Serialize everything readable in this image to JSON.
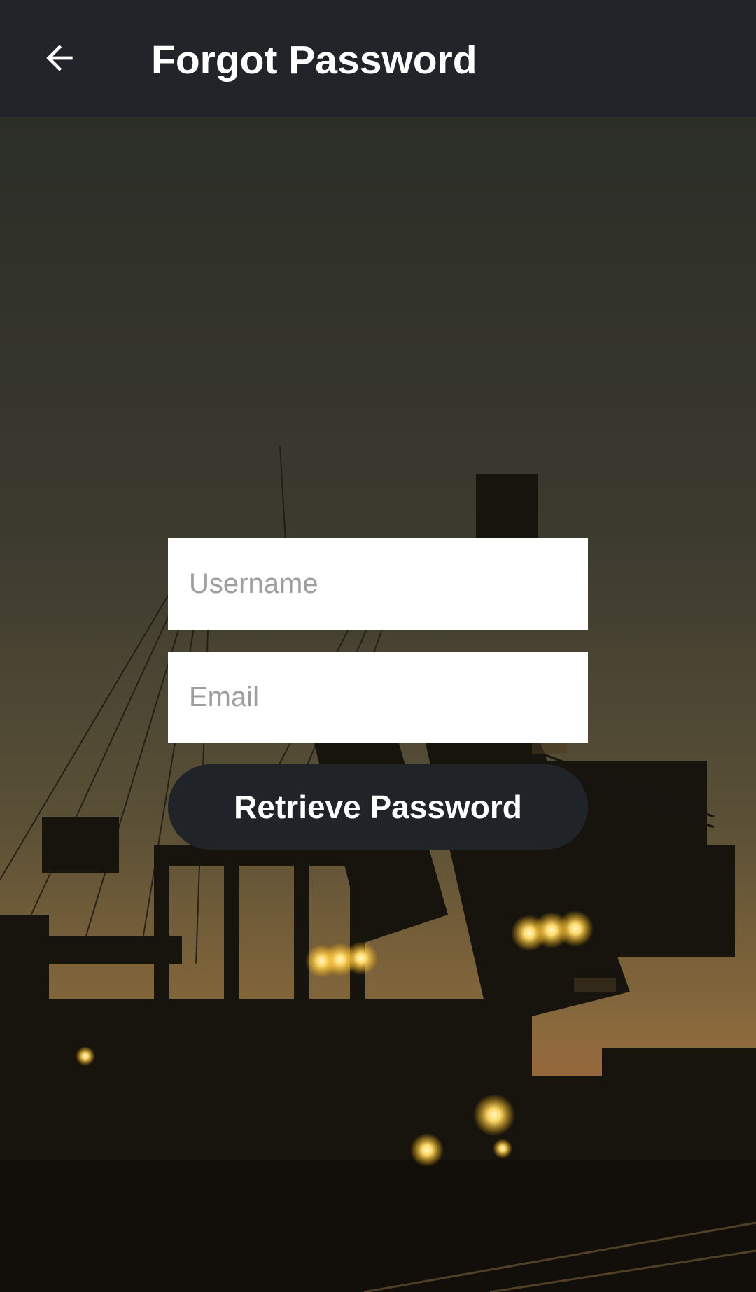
{
  "toolbar": {
    "title": "Forgot Password",
    "back_icon": "arrow-left-icon"
  },
  "form": {
    "username_placeholder": "Username",
    "username_value": "",
    "email_placeholder": "Email",
    "email_value": "",
    "submit_label": "Retrieve Password"
  },
  "colors": {
    "toolbar_bg": "#212429",
    "button_bg": "#202328",
    "text_light": "#ffffff",
    "placeholder": "#9e9e9e",
    "light_glow": "#ffd86b"
  }
}
